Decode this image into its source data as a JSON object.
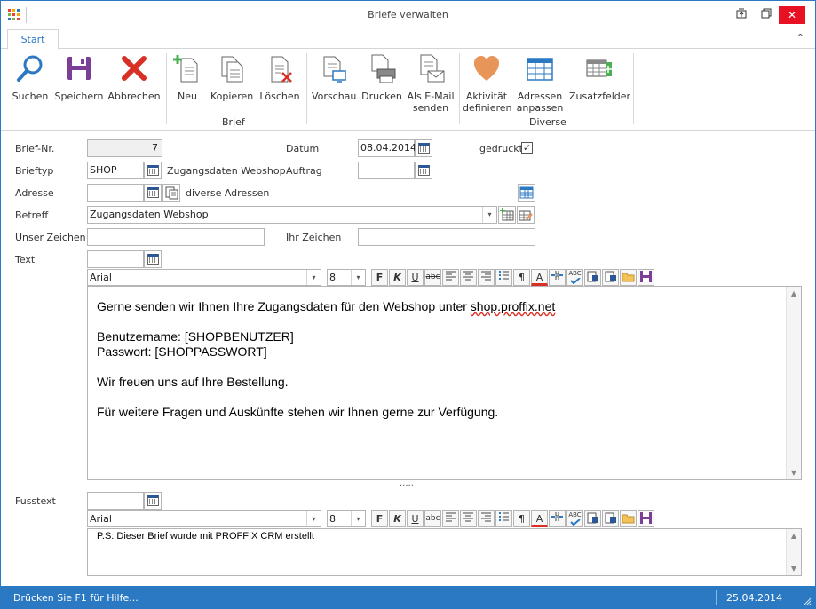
{
  "window": {
    "title": "Briefe verwalten",
    "maximize_glyph": "⊼",
    "restore_glyph": "□",
    "close_glyph": "✕"
  },
  "ribbon": {
    "tab": "Start",
    "collapse_glyph": "^",
    "buttons": {
      "suchen": "Suchen",
      "speichern": "Speichern",
      "abbrechen": "Abbrechen",
      "neu": "Neu",
      "kopieren": "Kopieren",
      "loeschen": "Löschen",
      "vorschau": "Vorschau",
      "drucken": "Drucken",
      "email_l1": "Als E-Mail",
      "email_l2": "senden",
      "aktivitaet_l1": "Aktivität",
      "aktivitaet_l2": "definieren",
      "adressen_l1": "Adressen",
      "adressen_l2": "anpassen",
      "zusatzfelder": "Zusatzfelder"
    },
    "groups": {
      "brief": "Brief",
      "diverse": "Diverse"
    },
    "icons": [
      "search-icon",
      "save-icon",
      "cancel-icon",
      "new-document-icon",
      "copy-icon",
      "delete-icon",
      "preview-icon",
      "print-icon",
      "email-icon",
      "heart-icon",
      "table-icon",
      "fields-icon"
    ],
    "colors": {
      "accent": "#2b79c2",
      "save": "#7b3f98",
      "cancel": "#d93025",
      "heart": "#e8955a"
    }
  },
  "form": {
    "brief_nr_label": "Brief-Nr.",
    "brief_nr_value": "7",
    "datum_label": "Datum",
    "datum_value": "08.04.2014",
    "gedruckt_label": "gedruckt",
    "gedruckt_check": "✓",
    "brieftyp_label": "Brieftyp",
    "brieftyp_value": "SHOP",
    "brieftyp_desc": "Zugangsdaten Webshop",
    "auftrag_label": "Auftrag",
    "auftrag_value": "",
    "adresse_label": "Adresse",
    "adresse_value": "",
    "adresse_desc": "diverse Adressen",
    "betreff_label": "Betreff",
    "betreff_value": "Zugangsdaten Webshop",
    "unser_zeichen_label": "Unser Zeichen",
    "unser_zeichen_value": "",
    "ihr_zeichen_label": "Ihr Zeichen",
    "ihr_zeichen_value": "",
    "text_label": "Text",
    "fusstext_label": "Fusstext"
  },
  "toolbar": {
    "font": "Arial",
    "size": "8",
    "dropdown_glyph": "▾",
    "bold": "F",
    "italic": "K",
    "underline": "U",
    "strike": "abc",
    "para": "¶",
    "color": "A",
    "spell": "ABC"
  },
  "text_editor": {
    "line1_pre": "Gerne senden wir Ihnen Ihre Zugangsdaten für den Webshop unter ",
    "line1_link": "shop.proffix.net",
    "line2": "Benutzername: [SHOPBENUTZER]",
    "line3": "Passwort: [SHOPPASSWORT]",
    "line4": "Wir freuen uns auf Ihre Bestellung.",
    "line5": "Für weitere Fragen und Auskünfte stehen wir Ihnen gerne zur Verfügung.",
    "splitter": "....."
  },
  "footer_editor": {
    "text": "P.S: Dieser Brief wurde mit PROFFIX CRM erstellt"
  },
  "scroll": {
    "up": "▲",
    "down": "▼"
  },
  "status": {
    "help": "Drücken Sie F1 für Hilfe...",
    "date": "25.04.2014"
  }
}
